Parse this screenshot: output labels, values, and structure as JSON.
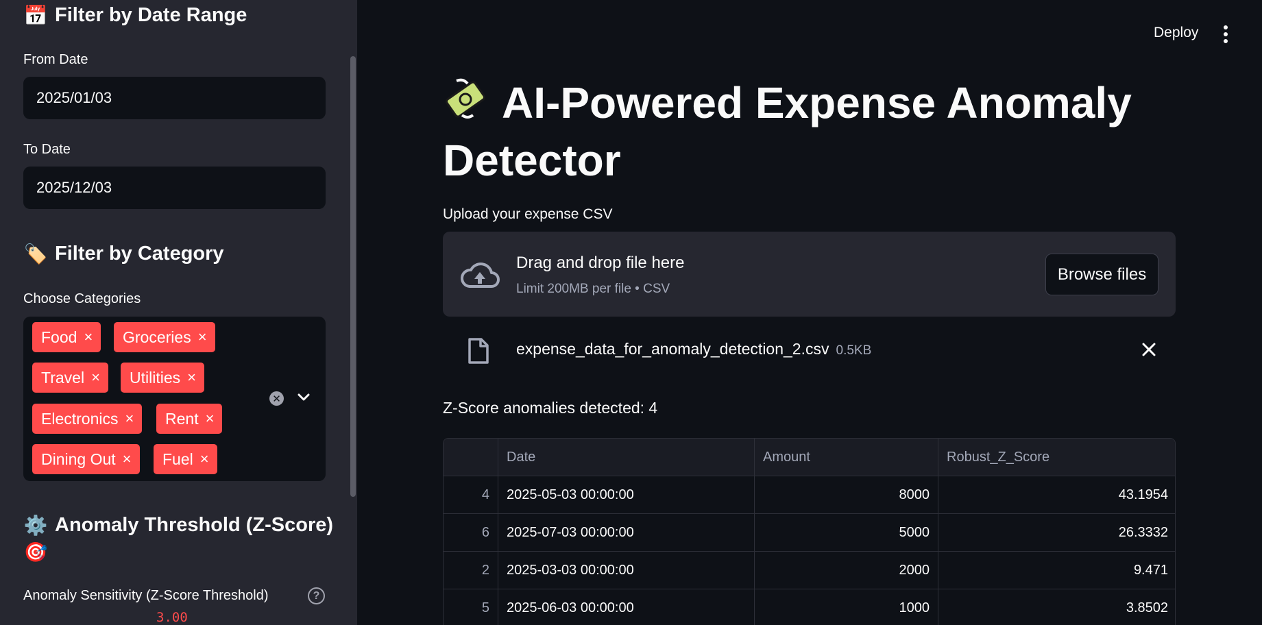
{
  "sidebar": {
    "date_section": {
      "emoji": "📅",
      "title": "Filter by Date Range"
    },
    "from_date": {
      "label": "From Date",
      "value": "2025/01/03"
    },
    "to_date": {
      "label": "To Date",
      "value": "2025/12/03"
    },
    "category_section": {
      "emoji": "🏷️",
      "title": "Filter by Category"
    },
    "categories": {
      "label": "Choose Categories",
      "selected": [
        "Food",
        "Groceries",
        "Travel",
        "Utilities",
        "Electronics",
        "Rent",
        "Dining Out",
        "Fuel"
      ],
      "remove_glyph": "×"
    },
    "threshold_section": {
      "emoji": "⚙️",
      "title": "Anomaly Threshold (Z-Score)",
      "emoji2": "🎯"
    },
    "sensitivity": {
      "label": "Anomaly Sensitivity (Z-Score Threshold)",
      "value": "3.00",
      "help_glyph": "?"
    }
  },
  "toolbar": {
    "deploy_label": "Deploy"
  },
  "main": {
    "title": "AI-Powered Expense Anomaly Detector",
    "upload": {
      "label": "Upload your expense CSV",
      "drop_text": "Drag and drop file here",
      "limit_text": "Limit 200MB per file • CSV",
      "browse_label": "Browse files"
    },
    "file": {
      "name": "expense_data_for_anomaly_detection_2.csv",
      "size": "0.5KB"
    },
    "anomaly_text": "Z-Score anomalies detected: 4",
    "table": {
      "columns": [
        "",
        "Date",
        "Amount",
        "Robust_Z_Score"
      ],
      "rows": [
        [
          "4",
          "2025-05-03 00:00:00",
          "8000",
          "43.1954"
        ],
        [
          "6",
          "2025-07-03 00:00:00",
          "5000",
          "26.3332"
        ],
        [
          "2",
          "2025-03-03 00:00:00",
          "2000",
          "9.471"
        ],
        [
          "5",
          "2025-06-03 00:00:00",
          "1000",
          "3.8502"
        ]
      ]
    }
  },
  "colors": {
    "accent": "#ff4b4b",
    "sidebar_bg": "#262730",
    "main_bg": "#0e1117"
  }
}
